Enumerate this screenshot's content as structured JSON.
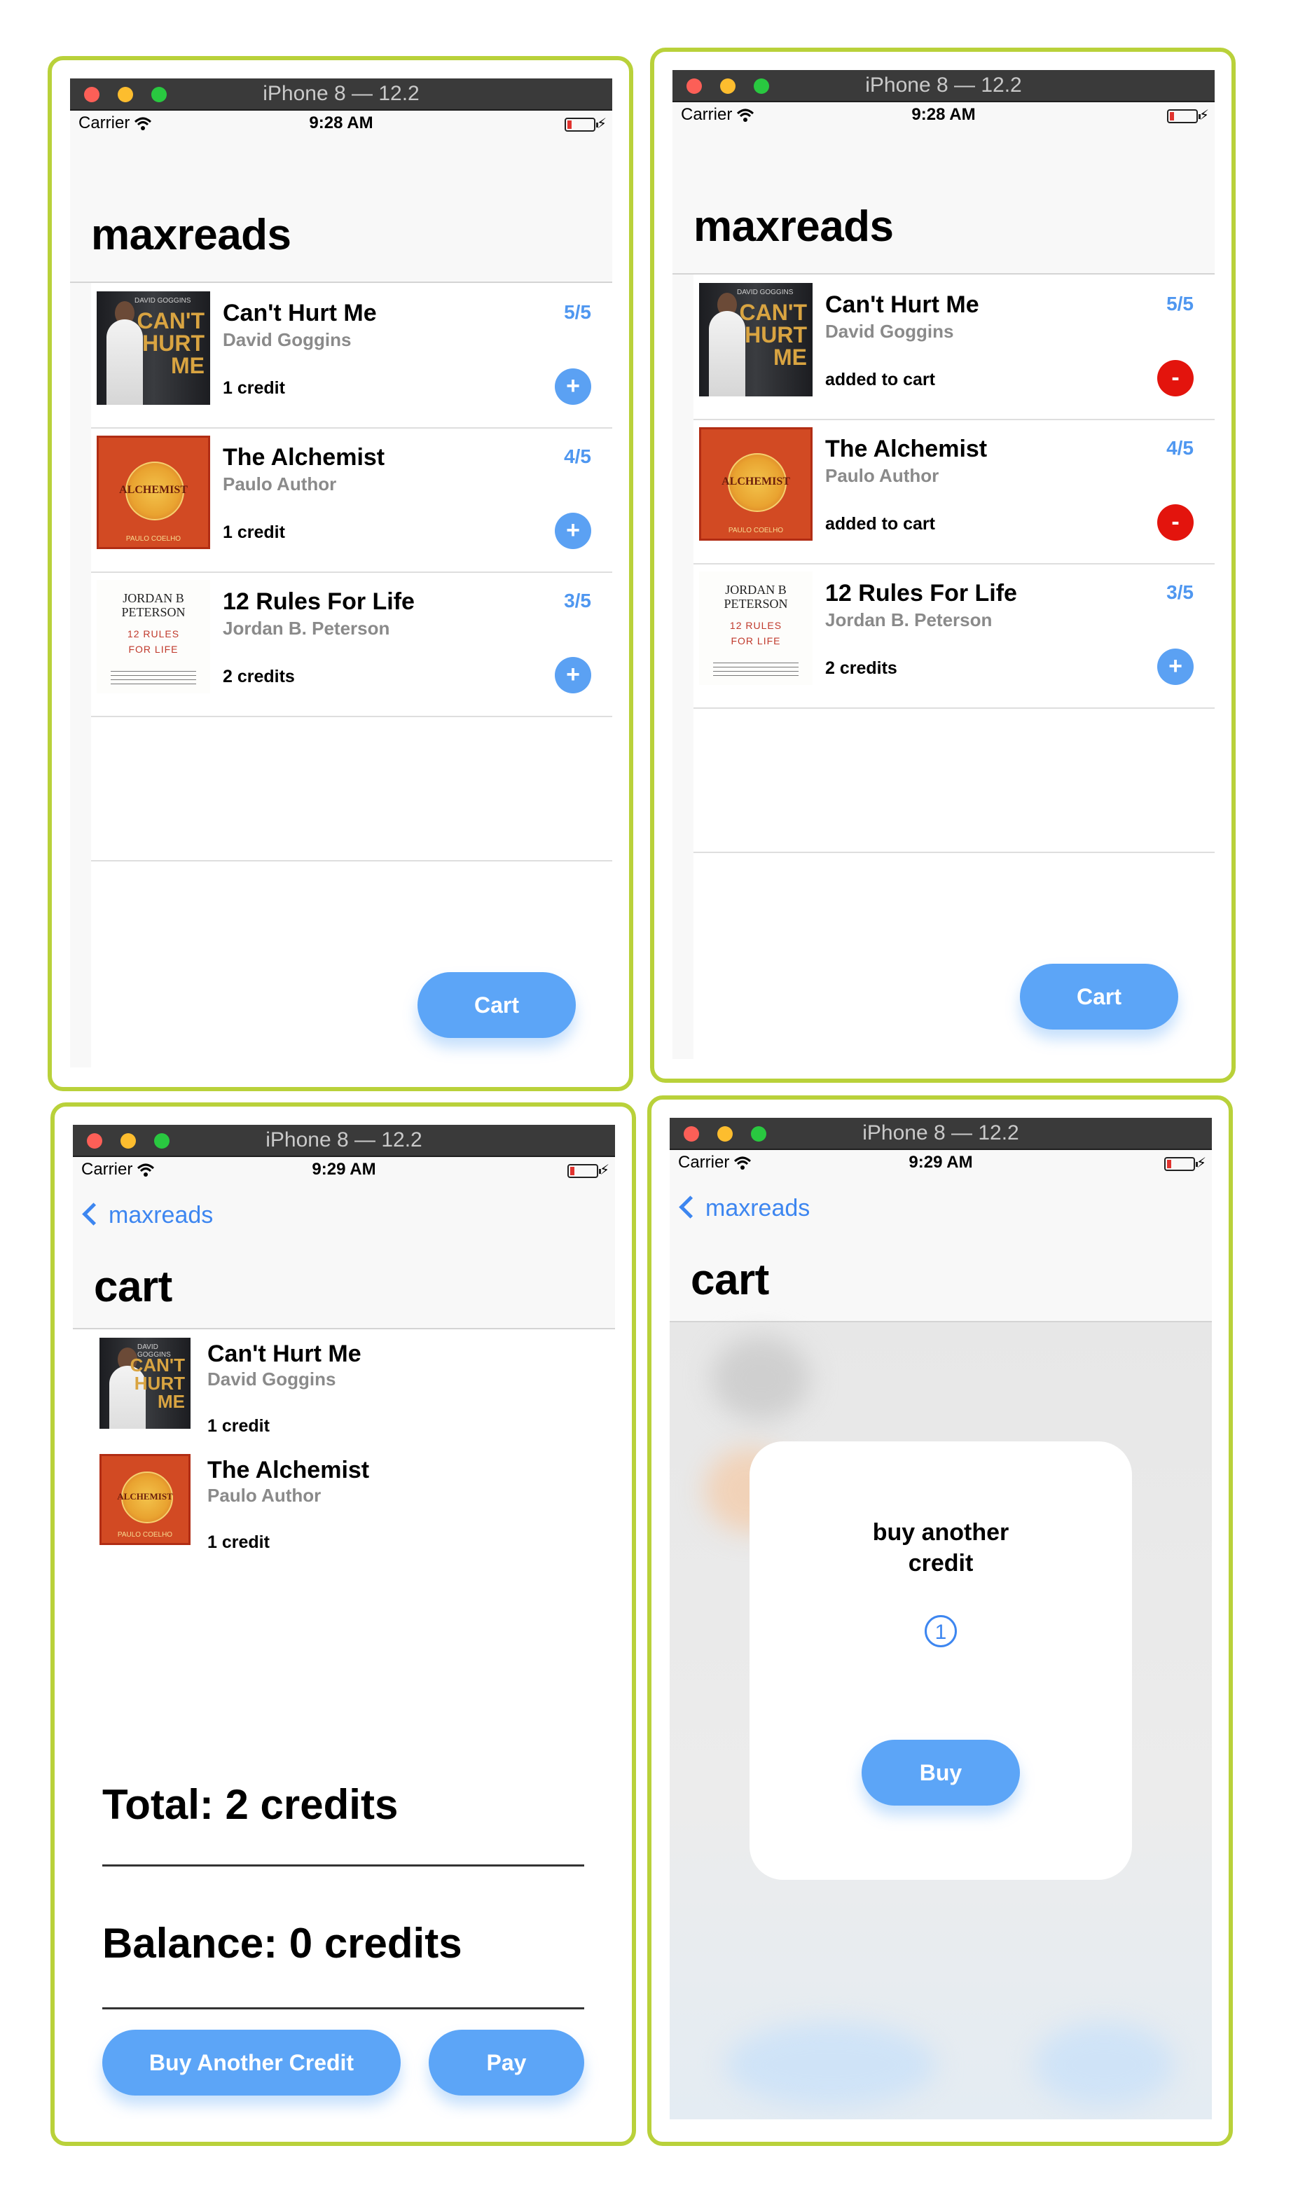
{
  "simulator": {
    "device_title": "iPhone 8 — 12.2",
    "carrier": "Carrier"
  },
  "screens": [
    {
      "time": "9:28 AM",
      "title": "maxreads",
      "books": [
        {
          "title": "Can't Hurt Me",
          "author": "David Goggins",
          "status": "1 credit",
          "rating": "5/5",
          "action": "+"
        },
        {
          "title": "The Alchemist",
          "author": "Paulo Author",
          "status": "1 credit",
          "rating": "4/5",
          "action": "+"
        },
        {
          "title": "12 Rules For Life",
          "author": "Jordan B. Peterson",
          "status": "2 credits",
          "rating": "3/5",
          "action": "+"
        }
      ],
      "cart_button": "Cart"
    },
    {
      "time": "9:28 AM",
      "title": "maxreads",
      "books": [
        {
          "title": "Can't Hurt Me",
          "author": "David Goggins",
          "status": "added to cart",
          "rating": "5/5",
          "action": "-"
        },
        {
          "title": "The Alchemist",
          "author": "Paulo Author",
          "status": "added to cart",
          "rating": "4/5",
          "action": "-"
        },
        {
          "title": "12 Rules For Life",
          "author": "Jordan B. Peterson",
          "status": "2 credits",
          "rating": "3/5",
          "action": "+"
        }
      ],
      "cart_button": "Cart"
    },
    {
      "time": "9:29 AM",
      "back": "maxreads",
      "title": "cart",
      "items": [
        {
          "title": "Can't Hurt Me",
          "author": "David Goggins",
          "credit": "1 credit"
        },
        {
          "title": "The Alchemist",
          "author": "Paulo Author",
          "credit": "1 credit"
        }
      ],
      "total": "Total: 2 credits",
      "balance": "Balance: 0 credits",
      "buy_another_button": "Buy Another Credit",
      "pay_button": "Pay"
    },
    {
      "time": "9:29 AM",
      "back": "maxreads",
      "title": "cart",
      "modal": {
        "line1": "buy another",
        "line2": "credit",
        "count": "1",
        "buy_button": "Buy"
      }
    }
  ],
  "covers": {
    "cant_hurt_me": {
      "author": "DAVID GOGGINS",
      "line1": "CAN'T",
      "line2": "HURT",
      "line3": "ME"
    },
    "alchemist": {
      "title": "ALCHEMIST",
      "foot": "PAULO COELHO"
    },
    "twelve_rules": {
      "author1": "JORDAN B",
      "author2": "PETERSON",
      "t1": "12 RULES",
      "t2": "FOR LIFE"
    }
  }
}
